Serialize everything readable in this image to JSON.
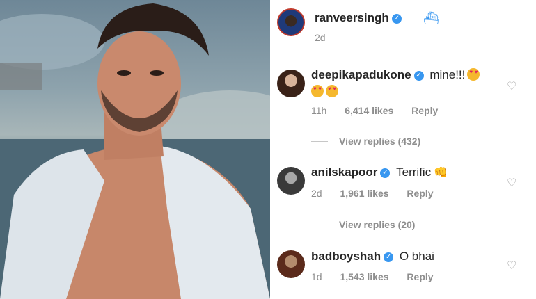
{
  "post": {
    "author": "ranveersingh",
    "author_verified_glyph": "✓",
    "author_emoji_icon": "ship-icon",
    "time_ago": "2d"
  },
  "comments": [
    {
      "username": "deepikapadukone",
      "verified_glyph": "✓",
      "text": "mine!!!",
      "emojis": [
        "heart-eyes-emoji",
        "heart-eyes-emoji",
        "heart-eyes-emoji"
      ],
      "time_ago": "11h",
      "likes": "6,414 likes",
      "reply_label": "Reply",
      "view_replies": "View replies (432)"
    },
    {
      "username": "anilskapoor",
      "verified_glyph": "✓",
      "text": "Terrific",
      "emojis": [
        "fist-emoji"
      ],
      "time_ago": "2d",
      "likes": "1,961 likes",
      "reply_label": "Reply",
      "view_replies": "View replies (20)"
    },
    {
      "username": "badboyshah",
      "verified_glyph": "✓",
      "text": "O bhai",
      "emojis": [],
      "time_ago": "1d",
      "likes": "1,543 likes",
      "reply_label": "Reply"
    }
  ],
  "icons": {
    "heart": "♡",
    "fist": "👊"
  },
  "colors": {
    "verified_blue": "#3897f0",
    "meta_gray": "#8e8e8e"
  }
}
